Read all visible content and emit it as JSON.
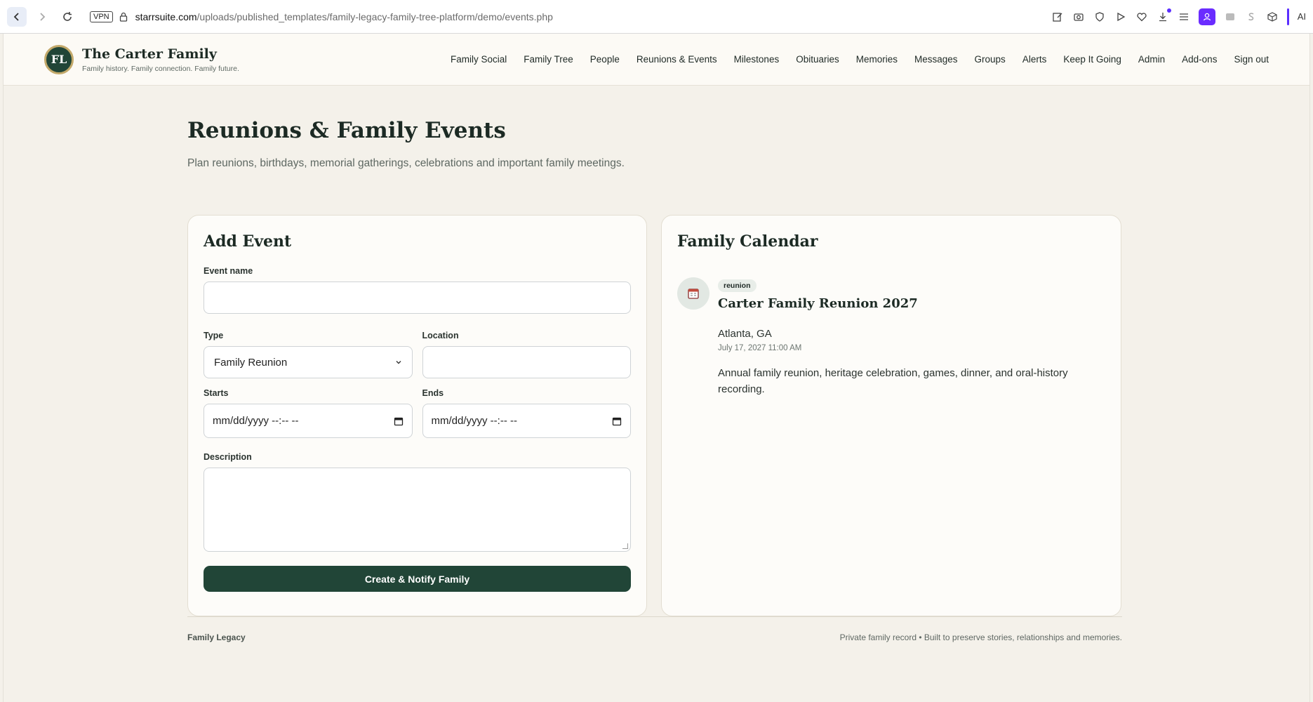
{
  "browser": {
    "vpn_label": "VPN",
    "url_host": "starrsuite.com",
    "url_path": "/uploads/published_templates/family-legacy-family-tree-platform/demo/events.php",
    "ai_label": "AI"
  },
  "brand": {
    "logo_text": "FL",
    "name": "The Carter Family",
    "tagline": "Family history. Family connection. Family future."
  },
  "nav": {
    "items": [
      "Family Social",
      "Family Tree",
      "People",
      "Reunions & Events",
      "Milestones",
      "Obituaries",
      "Memories",
      "Messages",
      "Groups",
      "Alerts",
      "Keep It Going",
      "Admin",
      "Add-ons",
      "Sign out"
    ]
  },
  "page": {
    "title": "Reunions & Family Events",
    "subtitle": "Plan reunions, birthdays, memorial gatherings, celebrations and important family meetings."
  },
  "form": {
    "title": "Add Event",
    "event_name_label": "Event name",
    "event_name_value": "",
    "type_label": "Type",
    "type_value": "Family Reunion",
    "location_label": "Location",
    "location_value": "",
    "starts_label": "Starts",
    "starts_value": "mm/dd/yyyy --:-- --",
    "ends_label": "Ends",
    "ends_value": "mm/dd/yyyy --:-- --",
    "description_label": "Description",
    "description_value": "",
    "submit_label": "Create & Notify Family"
  },
  "calendar": {
    "title": "Family Calendar",
    "event": {
      "badge": "reunion",
      "title": "Carter Family Reunion 2027",
      "location": "Atlanta, GA",
      "datetime": "July 17, 2027 11:00 AM",
      "description": "Annual family reunion, heritage celebration, games, dinner, and oral-history recording."
    }
  },
  "footer": {
    "left": "Family Legacy",
    "right": "Private family record • Built to preserve stories, relationships and memories."
  }
}
